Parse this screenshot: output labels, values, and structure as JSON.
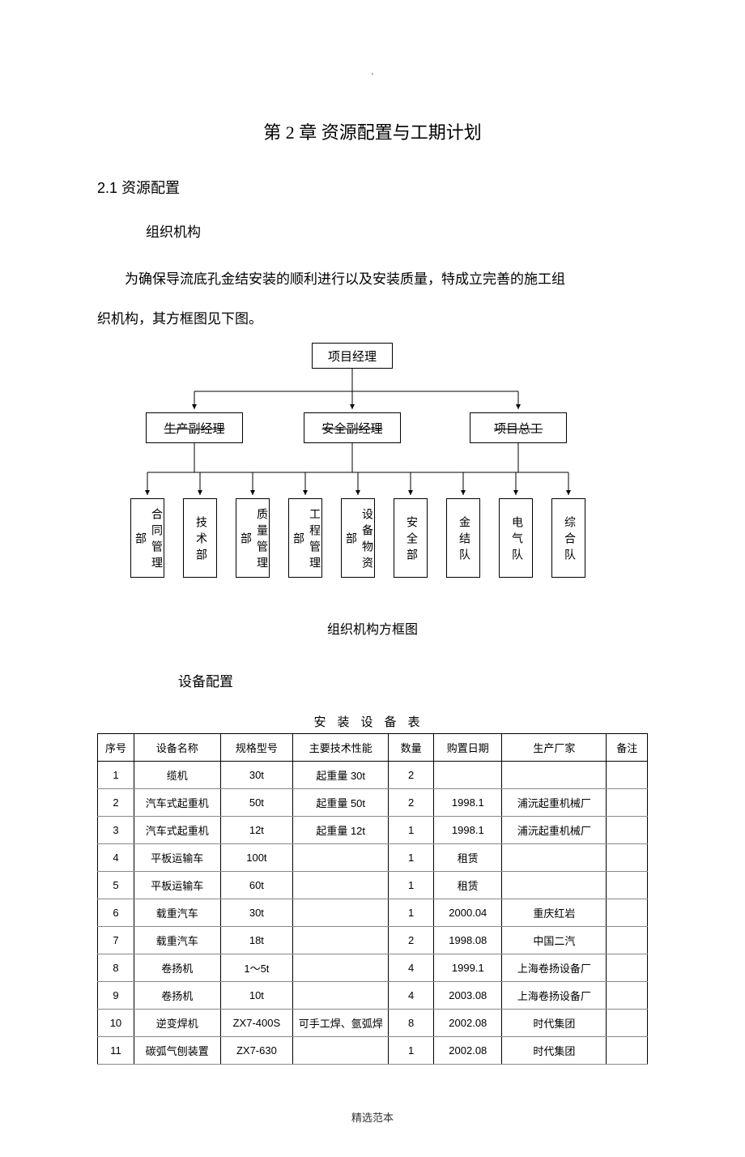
{
  "header_dot": ".",
  "chapter_title": "第 2 章 资源配置与工期计划",
  "section_2_1": "2.1 资源配置",
  "sub_org": "组织机构",
  "para1": "为确保导流底孔金结安装的顺利进行以及安装质量，特成立完善的施工组",
  "para2_prefix": "织机构，其方框图见下图。",
  "org": {
    "top": "项目经理",
    "mid": [
      "生产副经理",
      "安全副经理",
      "项目总工"
    ],
    "depts": [
      "合同管理部",
      "技术部",
      "质量管理部",
      "工程管理部",
      "设备物资部",
      "安全部",
      "金结队",
      "电气队",
      "综合队"
    ],
    "caption": "组织机构方框图"
  },
  "sub_equip": "设备配置",
  "equip_title": "安装设备表",
  "equip_headers": [
    "序号",
    "设备名称",
    "规格型号",
    "主要技术性能",
    "数量",
    "购置日期",
    "生产厂家",
    "备注"
  ],
  "equip_rows": [
    {
      "n": "1",
      "name": "缆机",
      "spec": "30t",
      "perf": "起重量 30t",
      "qty": "2",
      "date": "",
      "maker": "",
      "note": ""
    },
    {
      "n": "2",
      "name": "汽车式起重机",
      "spec": "50t",
      "perf": "起重量 50t",
      "qty": "2",
      "date": "1998.1",
      "maker": "浦沅起重机械厂",
      "note": ""
    },
    {
      "n": "3",
      "name": "汽车式起重机",
      "spec": "12t",
      "perf": "起重量 12t",
      "qty": "1",
      "date": "1998.1",
      "maker": "浦沅起重机械厂",
      "note": ""
    },
    {
      "n": "4",
      "name": "平板运输车",
      "spec": "100t",
      "perf": "",
      "qty": "1",
      "date": "租赁",
      "maker": "",
      "note": ""
    },
    {
      "n": "5",
      "name": "平板运输车",
      "spec": "60t",
      "perf": "",
      "qty": "1",
      "date": "租赁",
      "maker": "",
      "note": ""
    },
    {
      "n": "6",
      "name": "载重汽车",
      "spec": "30t",
      "perf": "",
      "qty": "1",
      "date": "2000.04",
      "maker": "重庆红岩",
      "note": ""
    },
    {
      "n": "7",
      "name": "载重汽车",
      "spec": "18t",
      "perf": "",
      "qty": "2",
      "date": "1998.08",
      "maker": "中国二汽",
      "note": ""
    },
    {
      "n": "8",
      "name": "卷扬机",
      "spec": "1～5t",
      "perf": "",
      "qty": "4",
      "date": "1999.1",
      "maker": "上海卷扬设备厂",
      "note": ""
    },
    {
      "n": "9",
      "name": "卷扬机",
      "spec": "10t",
      "perf": "",
      "qty": "4",
      "date": "2003.08",
      "maker": "上海卷扬设备厂",
      "note": ""
    },
    {
      "n": "10",
      "name": "逆变焊机",
      "spec": "ZX7-400S",
      "perf": "可手工焊、氩弧焊",
      "qty": "8",
      "date": "2002.08",
      "maker": "时代集团",
      "note": ""
    },
    {
      "n": "11",
      "name": "碳弧气刨装置",
      "spec": "ZX7-630",
      "perf": "",
      "qty": "1",
      "date": "2002.08",
      "maker": "时代集团",
      "note": ""
    }
  ],
  "footer": "精选范本"
}
